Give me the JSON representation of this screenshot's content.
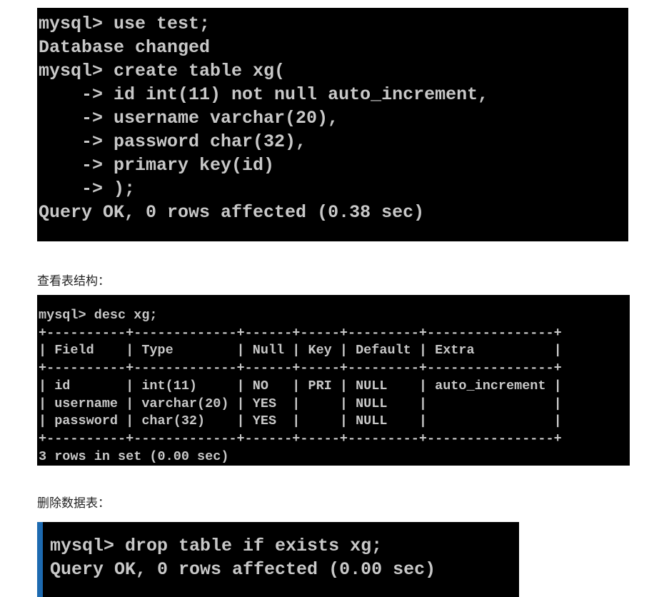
{
  "blocks": {
    "create": {
      "lines": [
        "mysql> use test;",
        "Database changed",
        "mysql> create table xg(",
        "    -> id int(11) not null auto_increment,",
        "    -> username varchar(20),",
        "    -> password char(32),",
        "    -> primary key(id)",
        "    -> );",
        "Query OK, 0 rows affected (0.38 sec)"
      ]
    },
    "desc_caption": "查看表结构：",
    "desc": {
      "lines": [
        "mysql> desc xg;",
        "+----------+-------------+------+-----+---------+----------------+",
        "| Field    | Type        | Null | Key | Default | Extra          |",
        "+----------+-------------+------+-----+---------+----------------+",
        "| id       | int(11)     | NO   | PRI | NULL    | auto_increment |",
        "| username | varchar(20) | YES  |     | NULL    |                |",
        "| password | char(32)    | YES  |     | NULL    |                |",
        "+----------+-------------+------+-----+---------+----------------+",
        "3 rows in set (0.00 sec)"
      ]
    },
    "drop_caption": "删除数据表：",
    "drop": {
      "lines": [
        "mysql> drop table if exists xg;",
        "Query OK, 0 rows affected (0.00 sec)"
      ]
    }
  },
  "colors": {
    "terminal_bg": "#000000",
    "terminal_text": "#c8c8c8",
    "accent_bar": "#1d6ab0"
  }
}
